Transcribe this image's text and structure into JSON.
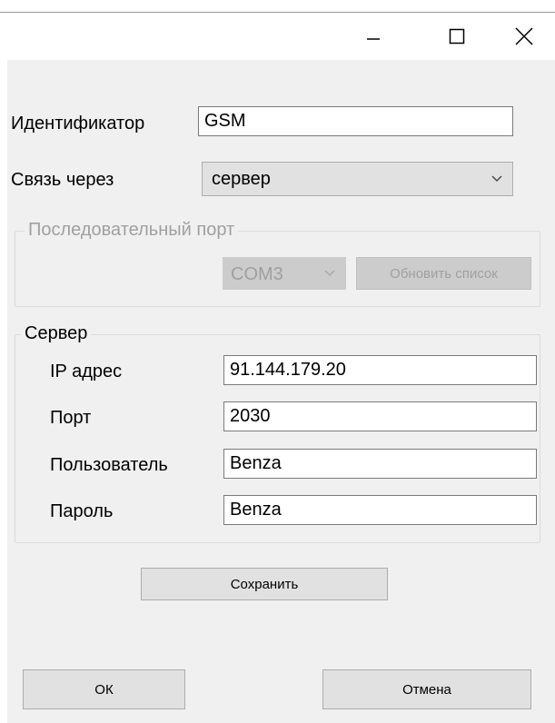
{
  "window": {
    "minimize_label": "minimize",
    "maximize_label": "maximize",
    "close_label": "close"
  },
  "form": {
    "identifier_label": "Идентификатор",
    "identifier_value": "GSM",
    "connection_label": "Связь через",
    "connection_value": "сервер"
  },
  "serial_group": {
    "title": "Последовательный порт",
    "port_value": "COM3",
    "refresh_label": "Обновить список"
  },
  "server_group": {
    "title": "Сервер",
    "ip_label": "IP адрес",
    "ip_value": "91.144.179.20",
    "port_label": "Порт",
    "port_value": "2030",
    "user_label": "Пользователь",
    "user_value": "Benza",
    "password_label": "Пароль",
    "password_value": "Benza"
  },
  "buttons": {
    "save_label": "Сохранить",
    "ok_label": "ОК",
    "cancel_label": "Отмена"
  },
  "colors": {
    "client_bg": "#f0f0f0",
    "button_bg": "#e1e1e1",
    "disabled_text": "#a0a0a0"
  }
}
